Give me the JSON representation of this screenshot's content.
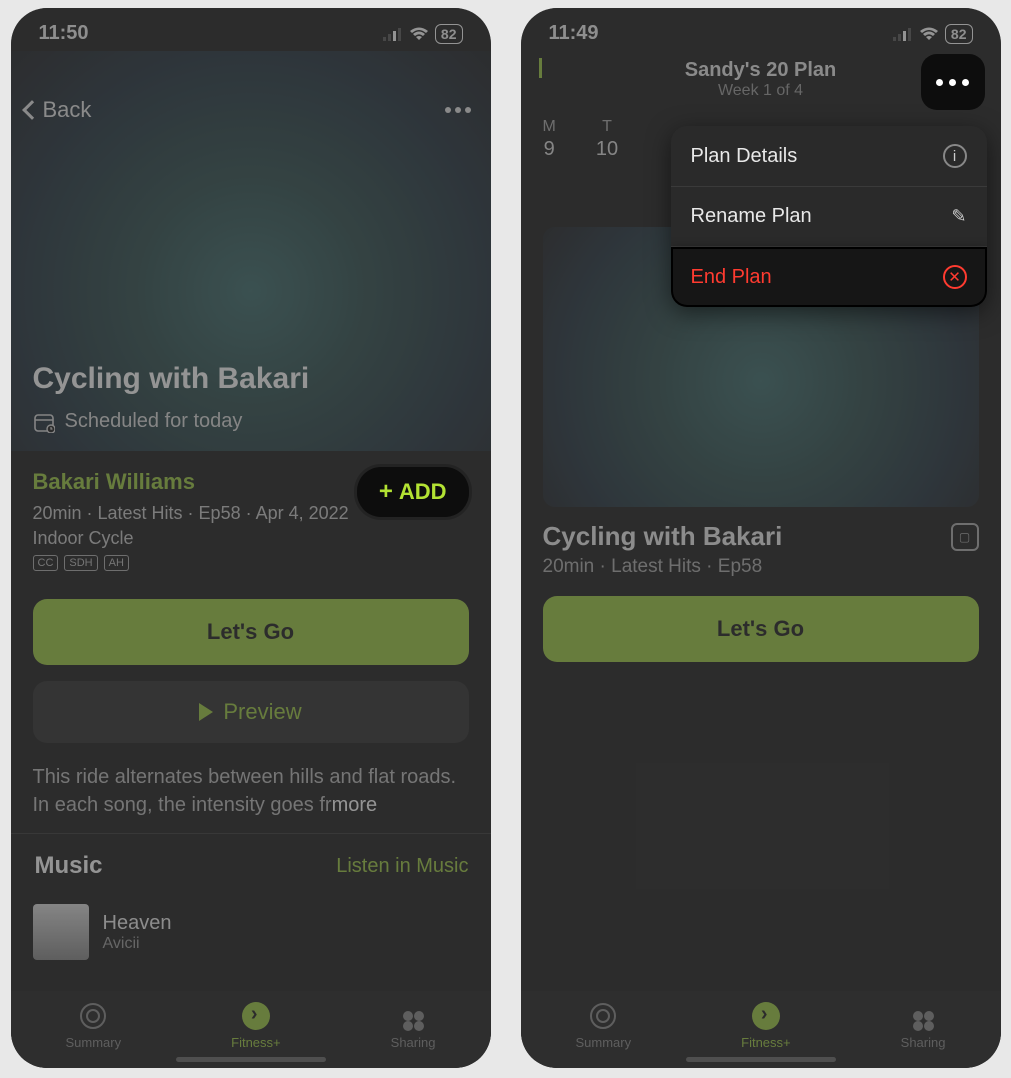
{
  "phone1": {
    "status": {
      "time": "11:50",
      "battery": "82"
    },
    "nav": {
      "back": "Back"
    },
    "hero": {
      "title": "Cycling with Bakari",
      "schedule": "Scheduled for today"
    },
    "trainer": {
      "name": "Bakari Williams",
      "meta1": "20min · Latest Hits · Ep58 · Apr 4, 2022",
      "meta2": "Indoor Cycle",
      "badges": [
        "CC",
        "SDH",
        "AH"
      ],
      "add": "ADD"
    },
    "buttons": {
      "go": "Let's Go",
      "preview": "Preview"
    },
    "desc": {
      "text": "This ride alternates between hills and flat roads. In each song, the intensity goes fr",
      "more": "more"
    },
    "music": {
      "brand": "Music",
      "link": "Listen in Music",
      "song": "Heaven",
      "artist": "Avicii"
    },
    "tabs": {
      "summary": "Summary",
      "fitness": "Fitness+",
      "sharing": "Sharing"
    }
  },
  "phone2": {
    "status": {
      "time": "11:49",
      "battery": "82"
    },
    "plan": {
      "title": "Sandy's 20 Plan",
      "sub": "Week 1 of 4"
    },
    "week": [
      {
        "d": "M",
        "n": "9"
      },
      {
        "d": "T",
        "n": "10"
      }
    ],
    "popup": {
      "details": "Plan Details",
      "rename": "Rename Plan",
      "end": "End Plan"
    },
    "card": {
      "title": "Cycling with Bakari",
      "meta": "20min · Latest Hits · Ep58"
    },
    "buttons": {
      "go": "Let's Go"
    },
    "tabs": {
      "summary": "Summary",
      "fitness": "Fitness+",
      "sharing": "Sharing"
    }
  }
}
